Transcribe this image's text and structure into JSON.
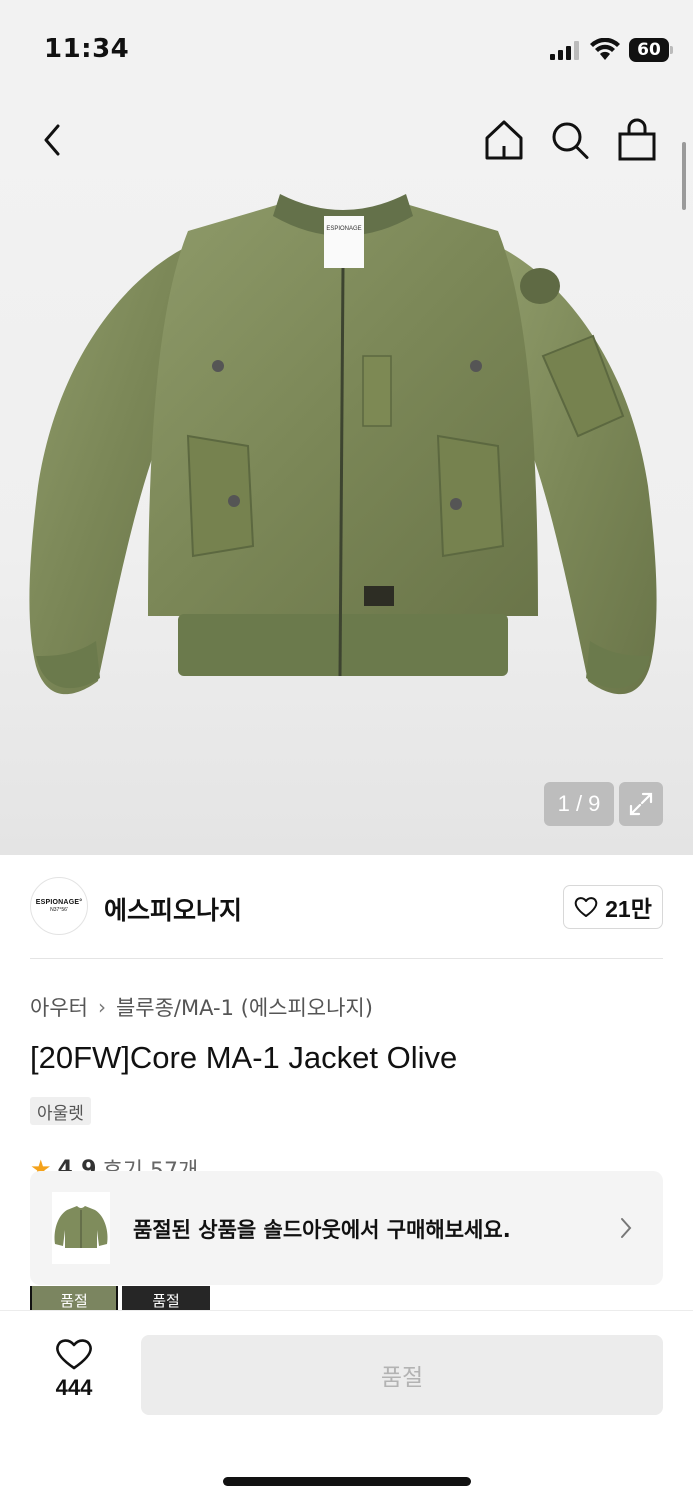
{
  "status_bar": {
    "time": "11:34",
    "battery": "60"
  },
  "gallery": {
    "counter": "1 / 9",
    "product_label_text": "ESPIONAGE",
    "icons": [
      "back-icon",
      "home-icon",
      "search-icon",
      "shopping-bag-icon",
      "expand-icon"
    ]
  },
  "brand": {
    "logo_line1": "ESPIONAGE°",
    "logo_line2": "N37°56'",
    "name": "에스피오나지",
    "likes": "21만"
  },
  "product": {
    "breadcrumb": [
      "아우터",
      "블루종/MA-1 (에스피오나지)"
    ],
    "title": "[20FW]Core MA-1 Jacket Olive",
    "badge": "아울렛",
    "rating": "4.9",
    "reviews": "후기 57개"
  },
  "banner": {
    "text": "품절된 상품을 솔드아웃에서 구매해보세요."
  },
  "swatches": [
    {
      "label": "품절"
    },
    {
      "label": "품절"
    }
  ],
  "bottom_bar": {
    "wish_count": "444",
    "buy_label": "품절"
  },
  "colors": {
    "jacket_olive": "#7f8c5c",
    "rating_star": "#f4a21b",
    "disabled_button": "#ececec"
  }
}
